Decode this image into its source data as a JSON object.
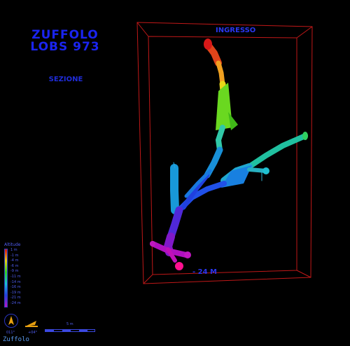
{
  "title": {
    "line1": "ZUFFOLO",
    "line2": "LOBS 973",
    "view": "SEZIONE"
  },
  "labels": {
    "entrance": "INGRESSO",
    "depth": "- 24 M"
  },
  "legend": {
    "title": "Altitude",
    "values": [
      "1 m",
      "-1 m",
      "-4 m",
      "-6 m",
      "-9 m",
      "-11 m",
      "-14 m",
      "-16 m",
      "-19 m",
      "-21 m",
      "-24 m"
    ]
  },
  "compass": {
    "bearing": "011°",
    "inclination": "+04°"
  },
  "scale": {
    "label": "5 m"
  },
  "brand": "Zuffolo",
  "colors": {
    "background": "#000000",
    "frame": "#c01818",
    "title": "#1a24f0",
    "label": "#2a36f0"
  }
}
